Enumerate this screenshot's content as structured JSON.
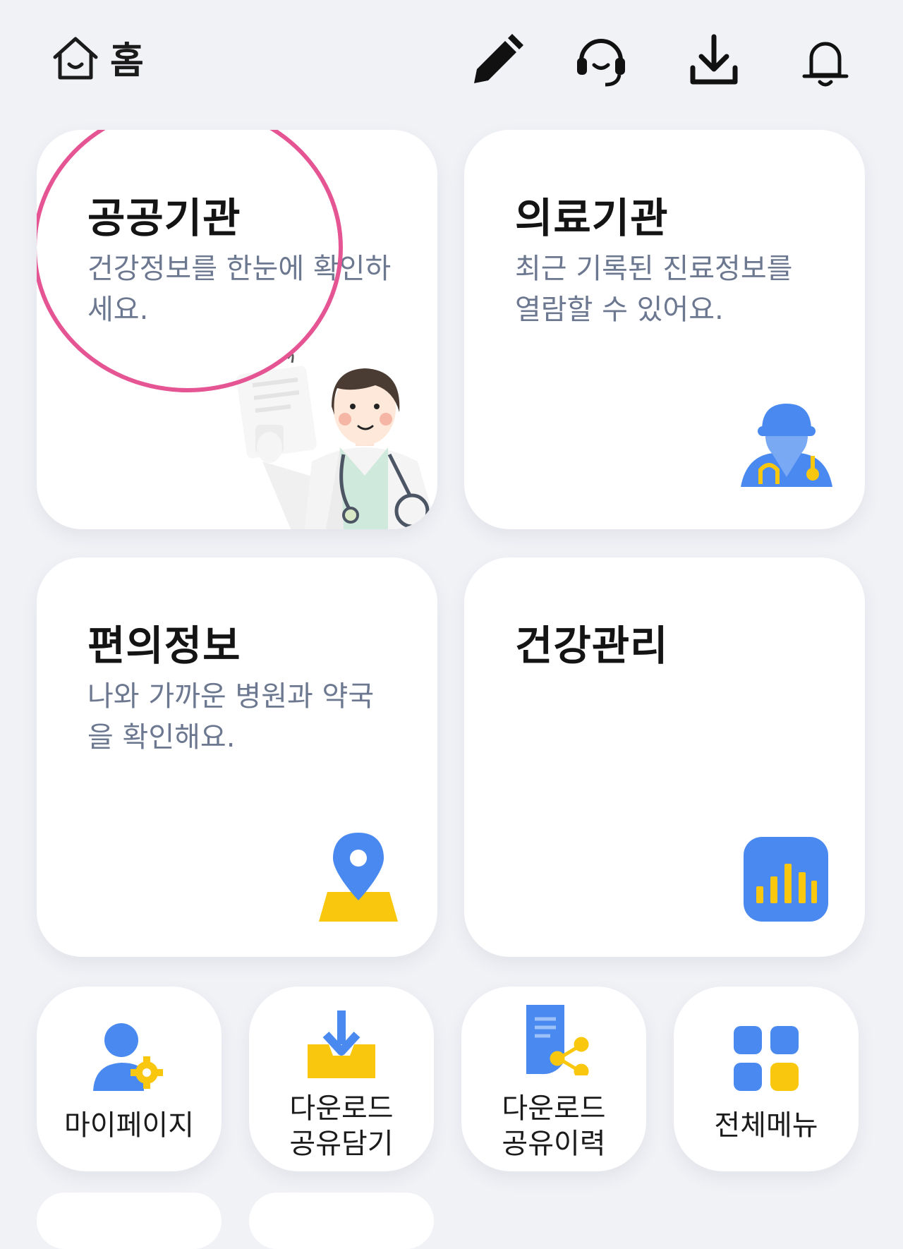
{
  "header": {
    "home_label": "홈",
    "icons": [
      "home-icon",
      "pencil-icon",
      "headset-icon",
      "download-icon",
      "bell-icon"
    ]
  },
  "cards": {
    "public_institution": {
      "title": "공공기관",
      "desc": "건강정보를 한눈에 확인하세요."
    },
    "medical_institution": {
      "title": "의료기관",
      "desc": "최근 기록된 진료정보를 열람할 수 있어요."
    },
    "convenience_info": {
      "title": "편의정보",
      "desc": "나와 가까운 병원과 약국을 확인해요."
    },
    "health_management": {
      "title": "건강관리"
    }
  },
  "quick_menu": {
    "mypage": "마이페이지",
    "download_share_cart": "다운로드\n공유담기",
    "download_share_history": "다운로드\n공유이력",
    "all_menu": "전체메뉴"
  },
  "colors": {
    "background": "#f1f2f6",
    "card": "#ffffff",
    "accent_blue": "#4a8af0",
    "accent_yellow": "#f9c80e",
    "annotation_pink": "#e65593",
    "desc_text": "#6c7790"
  }
}
